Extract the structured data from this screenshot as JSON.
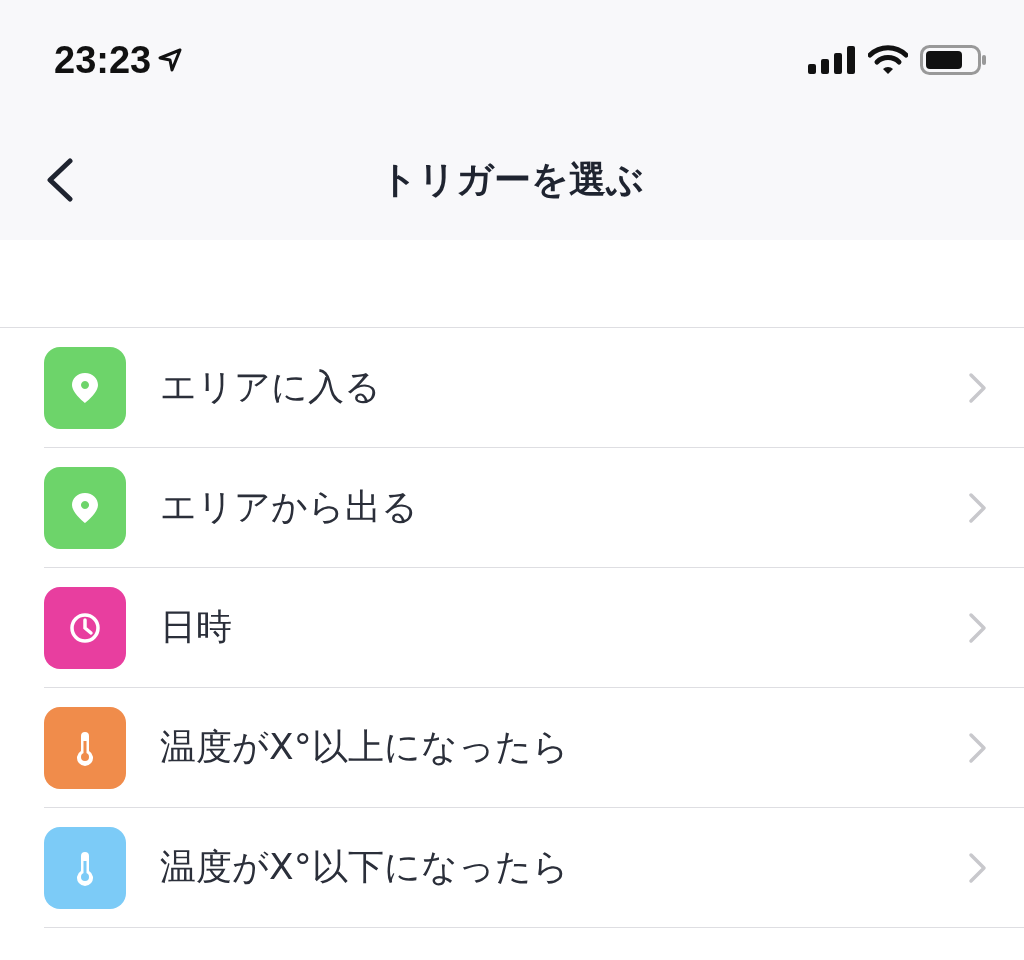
{
  "status_bar": {
    "time": "23:23"
  },
  "nav": {
    "title": "トリガーを選ぶ"
  },
  "items": [
    {
      "label": "エリアに入る",
      "kind": "location",
      "color": "#6dd46a"
    },
    {
      "label": "エリアから出る",
      "kind": "location",
      "color": "#6dd46a"
    },
    {
      "label": "日時",
      "kind": "clock",
      "color": "#e83e9f"
    },
    {
      "label": "温度がX°以上になったら",
      "kind": "thermometer",
      "color": "#f08c4b"
    },
    {
      "label": "温度がX°以下になったら",
      "kind": "thermometer",
      "color": "#7ccbf7"
    }
  ]
}
